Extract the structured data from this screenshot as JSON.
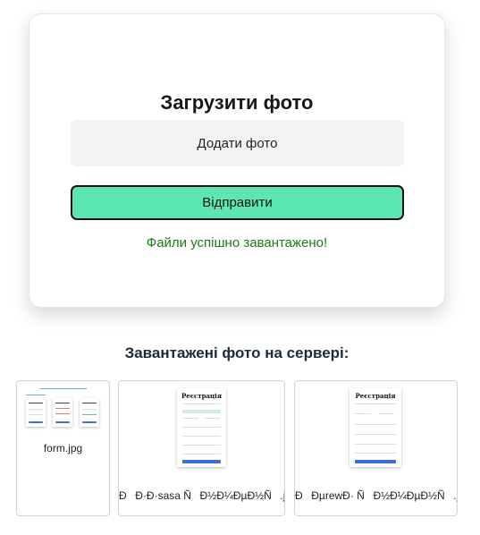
{
  "upload_card": {
    "title": "Загрузити фото",
    "add_photo_label": "Додати фото",
    "submit_label": "Відправити",
    "success_message": "Файли успішно завантажено!"
  },
  "gallery": {
    "title": "Завантажені фото на сервері:",
    "items": [
      {
        "caption": "form.jpg",
        "preview_title": ""
      },
      {
        "caption": "ÐÐ·Ð·sasa ÑÐ½Ð¼ÐµÐ½Ñ.jpg",
        "preview_title": "Реєстрація"
      },
      {
        "caption": "ÐÐµrewÐ· ÑÐ½Ð¼ÐµÐ½Ñ.jpg",
        "preview_title": "Реєстрація"
      }
    ]
  },
  "colors": {
    "accent": "#5ce6b4",
    "success": "#1c7a16",
    "field_bg": "#f3f3f3"
  }
}
